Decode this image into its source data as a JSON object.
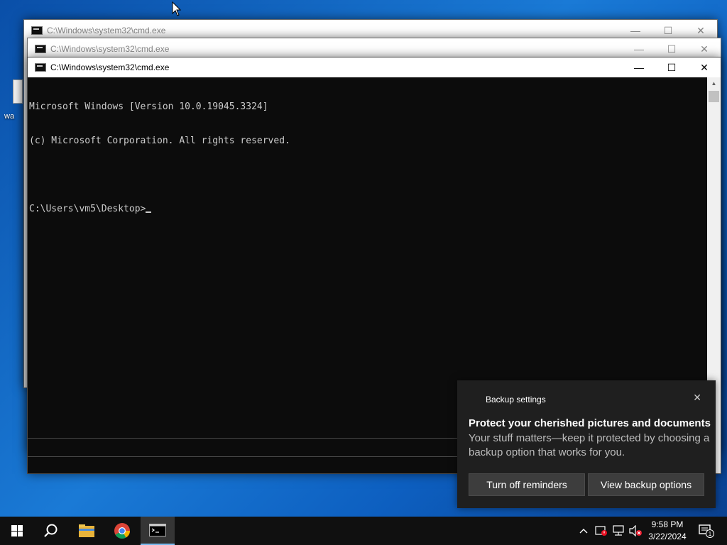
{
  "desktop": {
    "icon_label_fragment": "wa"
  },
  "windows": [
    {
      "title": "C:\\Windows\\system32\\cmd.exe"
    },
    {
      "title": "C:\\Windows\\system32\\cmd.exe"
    },
    {
      "title": "C:\\Windows\\system32\\cmd.exe"
    }
  ],
  "window_controls": {
    "minimize": "—",
    "maximize": "☐",
    "close": "✕"
  },
  "console": {
    "lines": [
      "Microsoft Windows [Version 10.0.19045.3324]",
      "(c) Microsoft Corporation. All rights reserved.",
      ""
    ],
    "prompt": "C:\\Users\\vm5\\Desktop>"
  },
  "toast": {
    "app_name": "Backup settings",
    "heading": "Protect your cherished pictures and documents",
    "body": "Your stuff matters—keep it protected by choosing a backup option that works for you.",
    "button_1": "Turn off reminders",
    "button_2": "View backup options",
    "close_glyph": "✕"
  },
  "taskbar": {
    "items": [
      "start-button",
      "search-icon",
      "file-explorer-icon",
      "chrome-icon",
      "cmd-icon"
    ],
    "tray_chevron": "^",
    "time": "9:58 PM",
    "date": "3/22/2024",
    "notification_count": "1"
  },
  "colors": {
    "console_bg": "#0c0c0c",
    "console_fg": "#cccccc",
    "taskbar_bg": "#101010",
    "toast_bg": "#1f1f1f",
    "accent": "#76b9ed"
  }
}
